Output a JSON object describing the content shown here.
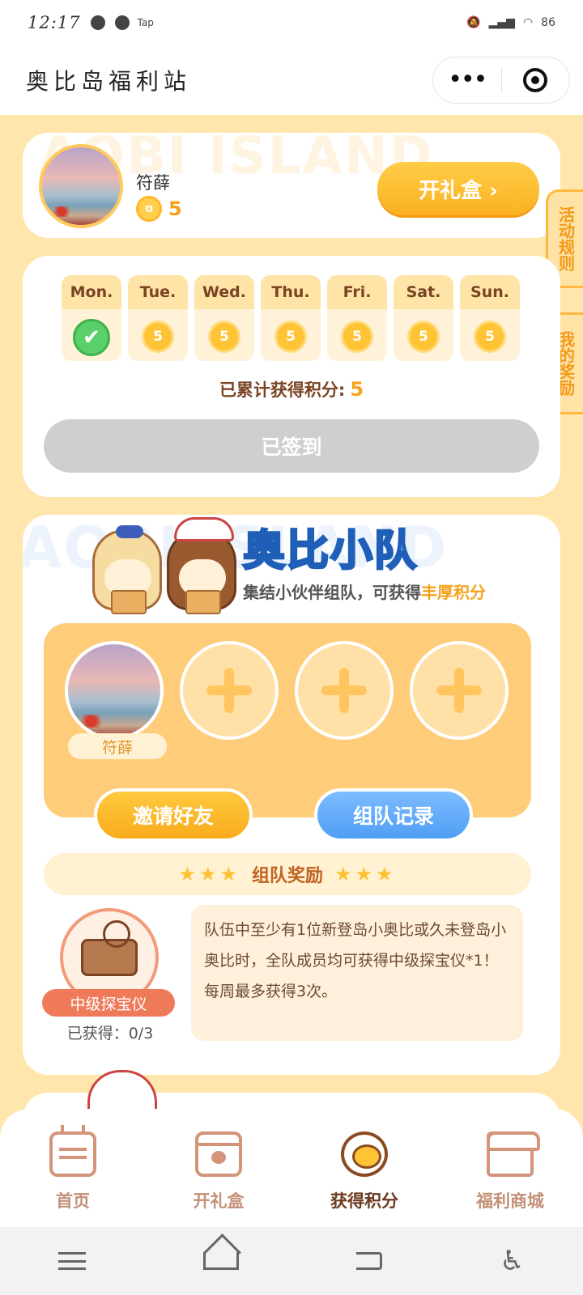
{
  "status_bar": {
    "time": "12:17",
    "tap_label": "Tap",
    "battery": "86"
  },
  "title_bar": {
    "title": "奥比岛福利站",
    "more_label": "•••"
  },
  "profile": {
    "username": "符薛",
    "points": "5",
    "open_box_label": "开礼盒 ›"
  },
  "side_tabs": {
    "rules": "活动规则",
    "my_rewards": "我的奖励"
  },
  "checkin": {
    "days": [
      {
        "name": "Mon.",
        "points": "5",
        "checked": true
      },
      {
        "name": "Tue.",
        "points": "5",
        "checked": false
      },
      {
        "name": "Wed.",
        "points": "5",
        "checked": false
      },
      {
        "name": "Thu.",
        "points": "5",
        "checked": false
      },
      {
        "name": "Fri.",
        "points": "5",
        "checked": false
      },
      {
        "name": "Sat.",
        "points": "5",
        "checked": false
      },
      {
        "name": "Sun.",
        "points": "5",
        "checked": false
      }
    ],
    "accum_label": "已累计获得积分:",
    "accum_value": "5",
    "signed_label": "已签到"
  },
  "team": {
    "bg_word": "AOBI ISLAND",
    "title": "奥比小队",
    "subtitle_prefix": "集结小伙伴组队，可获得",
    "subtitle_highlight": "丰厚积分",
    "member_name": "符薛",
    "invite_label": "邀请好友",
    "record_label": "组队记录",
    "reward_title": "组队奖励",
    "prize_name": "中级探宝仪",
    "prize_count": "已获得：0/3",
    "description": "队伍中至少有1位新登岛小奥比或久未登岛小奥比时，全队成员均可获得中级探宝仪*1！每周最多获得3次。"
  },
  "profile_bg_word": "AOBI ISLAND",
  "nav": {
    "items": [
      {
        "label": "首页",
        "icon": "calendar-icon"
      },
      {
        "label": "开礼盒",
        "icon": "gift-icon"
      },
      {
        "label": "获得积分",
        "icon": "bear-coin-icon",
        "active": true
      },
      {
        "label": "福利商城",
        "icon": "shop-icon"
      }
    ]
  },
  "colors": {
    "background": "#ffe6ad",
    "accent_orange": "#fbb122",
    "accent_blue": "#4f9ef5",
    "checked_green": "#5bd06a",
    "disabled_gray": "#cfcfcf"
  }
}
